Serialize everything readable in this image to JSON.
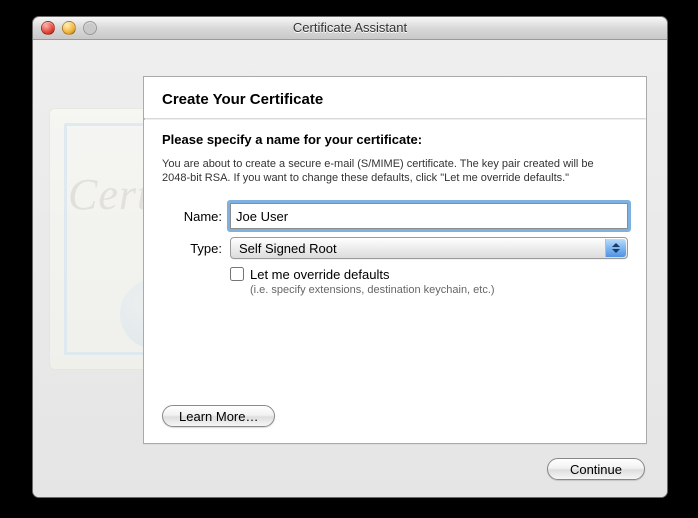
{
  "window": {
    "title": "Certificate Assistant"
  },
  "panel": {
    "heading": "Create Your Certificate",
    "instruction": "Please specify a name for your certificate:",
    "description": "You are about to create a secure e-mail (S/MIME) certificate. The key pair created will be 2048-bit RSA. If you want to change these defaults, click \"Let me override defaults.\"",
    "name_label": "Name:",
    "name_value": "Joe User",
    "type_label": "Type:",
    "type_value": "Self Signed Root",
    "override_label": "Let me override defaults",
    "override_sub": "(i.e. specify extensions, destination keychain, etc.)",
    "override_checked": false,
    "learn_more_label": "Learn More…"
  },
  "footer": {
    "continue_label": "Continue"
  }
}
